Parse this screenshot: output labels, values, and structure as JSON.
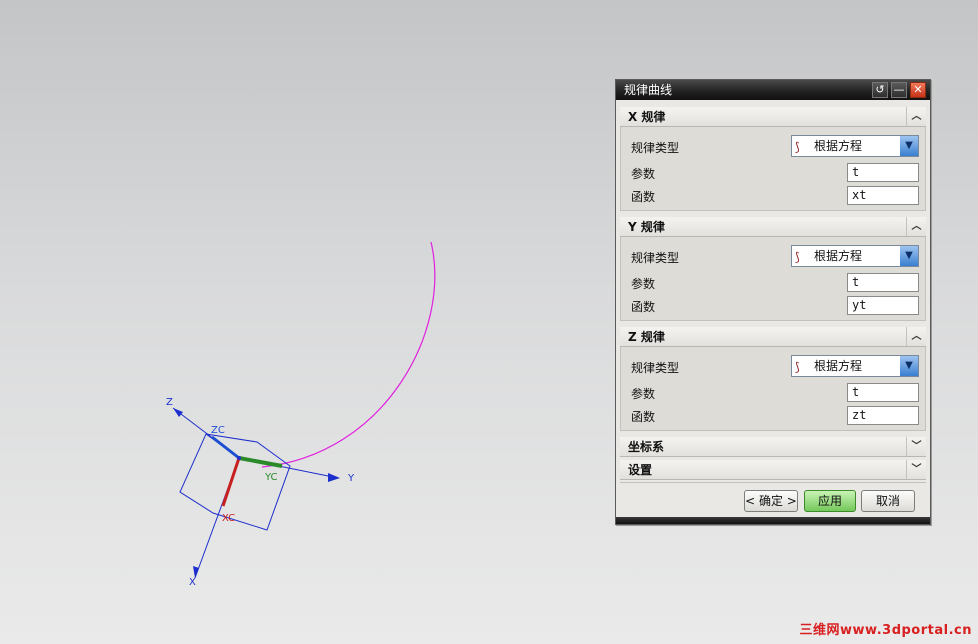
{
  "dialog": {
    "title": "规律曲线",
    "sections": [
      {
        "label": "X 规律",
        "type_label": "规律类型",
        "type_value": "根据方程",
        "param_label": "参数",
        "param_value": "t",
        "func_label": "函数",
        "func_value": "xt"
      },
      {
        "label": "Y 规律",
        "type_label": "规律类型",
        "type_value": "根据方程",
        "param_label": "参数",
        "param_value": "t",
        "func_label": "函数",
        "func_value": "yt"
      },
      {
        "label": "Z 规律",
        "type_label": "规律类型",
        "type_value": "根据方程",
        "param_label": "参数",
        "param_value": "t",
        "func_label": "函数",
        "func_value": "zt"
      }
    ],
    "coord_section": "坐标系",
    "settings_section": "设置",
    "ok_label": "< 确定 >",
    "apply_label": "应用",
    "cancel_label": "取消"
  },
  "viewport": {
    "axes": {
      "z": "Z",
      "y": "Y",
      "x": "X",
      "zc": "ZC",
      "yc": "YC",
      "xc": "XC"
    }
  },
  "watermark": "三维网www.3dportal.cn",
  "colors": {
    "curve": "#e020e0",
    "axis": "#1c2ecc",
    "xc": "#c82020",
    "yc": "#2a8a2a",
    "zc": "#1c4fd0"
  }
}
